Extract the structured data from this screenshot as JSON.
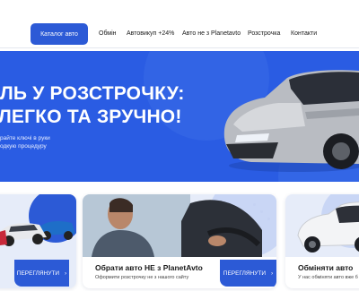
{
  "nav": {
    "catalog_label": "Каталог авто",
    "links": [
      "Обмін",
      "Автовикуп +24%",
      "Авто не з Planetavto",
      "Розстрочка",
      "Контакти"
    ]
  },
  "hero": {
    "title_line1": "ЛЬ У РОЗСТРОЧКУ:",
    "title_line2": "ЛЕГКО ТА ЗРУЧНО!",
    "subtitle_line1": "райте ключі в руки",
    "subtitle_line2": "одкую процедуру"
  },
  "cards": [
    {
      "button_label": "ПЕРЕГЛЯНУТИ",
      "title": "",
      "desc": ""
    },
    {
      "button_label": "ПЕРЕГЛЯНУТИ",
      "title": "Обрати авто НЕ з PlanetAvto",
      "desc": "Оформити розстрочку не з нашого сайту"
    },
    {
      "title": "Обміняти авто",
      "desc": "У нас обміняти авто вже б"
    }
  ],
  "colors": {
    "accent": "#2c5ad6",
    "hero_bg": "#2a5ce3"
  }
}
